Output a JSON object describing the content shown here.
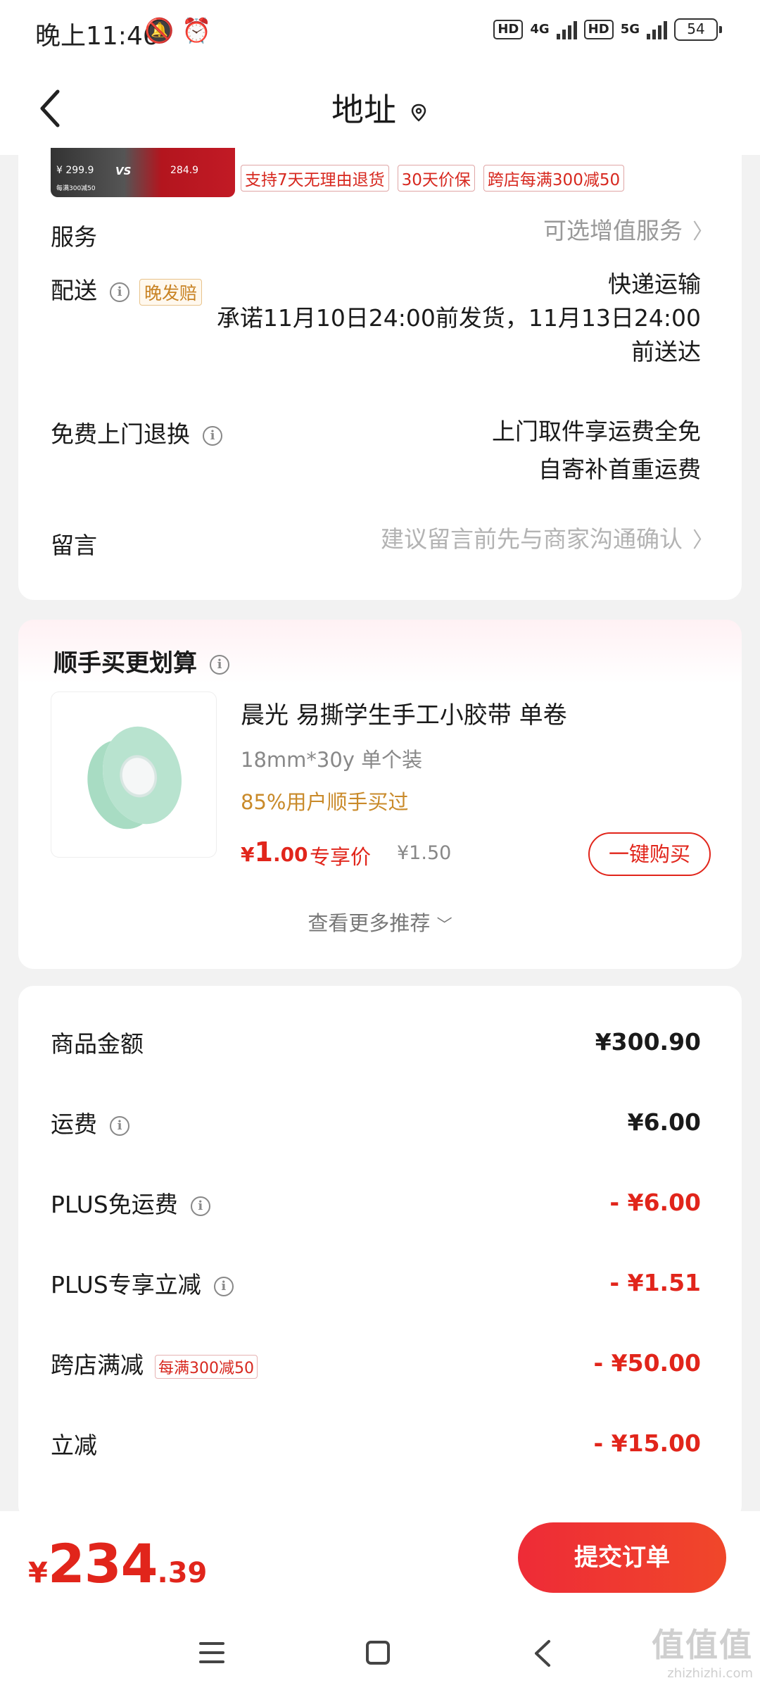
{
  "status_bar": {
    "time": "晚上11:46",
    "net1": "4G",
    "net2": "5G",
    "hd": "HD",
    "battery": "54"
  },
  "nav": {
    "title": "地址"
  },
  "product_thumb": {
    "left_text": "¥ 299.9",
    "vs": "VS",
    "right_text": "284.9",
    "small_text": "每满300减50"
  },
  "tags": [
    "支持7天无理由退货",
    "30天价保",
    "跨店每满300减50"
  ],
  "service": {
    "label": "服务",
    "value": "可选增值服务"
  },
  "delivery": {
    "label": "配送",
    "badge": "晚发赔",
    "method": "快递运输",
    "promise_line1": "承诺11月10日24:00前发货，11月13日24:00",
    "promise_line2": "前送达"
  },
  "return": {
    "label": "免费上门退换",
    "line1": "上门取件享运费全免",
    "line2": "自寄补首重运费"
  },
  "message": {
    "label": "留言",
    "placeholder": "建议留言前先与商家沟通确认"
  },
  "addon": {
    "title": "顺手买更划算",
    "product_name": "晨光 易撕学生手工小胶带 单卷",
    "spec": "18mm*30y 单个装",
    "bought": "85%用户顺手买过",
    "price_symbol": "¥",
    "price_int": "1",
    "price_dec": ".00",
    "price_label": "专享价",
    "original_price": "¥1.50",
    "buy_button": "一键购买",
    "more": "查看更多推荐"
  },
  "fees": [
    {
      "label": "商品金额",
      "value": "¥300.90",
      "red": false,
      "info": false,
      "badge": ""
    },
    {
      "label": "运费",
      "value": "¥6.00",
      "red": false,
      "info": true,
      "badge": ""
    },
    {
      "label": "PLUS免运费",
      "value": "- ¥6.00",
      "red": true,
      "info": true,
      "badge": ""
    },
    {
      "label": "PLUS专享立减",
      "value": "- ¥1.51",
      "red": true,
      "info": true,
      "badge": ""
    },
    {
      "label": "跨店满减",
      "value": "- ¥50.00",
      "red": true,
      "info": false,
      "badge": "每满300减50"
    },
    {
      "label": "立减",
      "value": "- ¥15.00",
      "red": true,
      "info": false,
      "badge": ""
    }
  ],
  "bottom": {
    "currency": "¥",
    "total_int": "234",
    "total_dec": ".39",
    "submit": "提交订单"
  },
  "watermark": {
    "line1": "值值值",
    "line2": "zhizhizhi.com"
  },
  "colors": {
    "accent": "#e1251b",
    "gold": "#c98a2a"
  }
}
